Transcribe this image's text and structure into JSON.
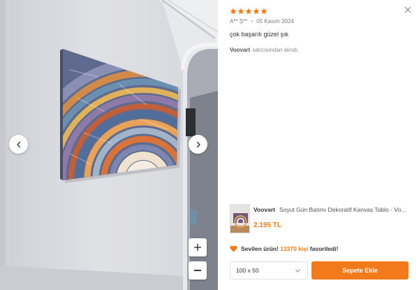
{
  "viewer": {
    "prev_icon": "chevron-left-icon",
    "next_icon": "chevron-right-icon",
    "zoom_in_icon": "plus-icon",
    "zoom_out_icon": "minus-icon"
  },
  "review": {
    "rating": 5,
    "rating_max": 5,
    "star_color": "#f27a1a",
    "author": "A** Ş**",
    "date": "05 Kasım 2024",
    "comment": "çok başarılı güzel şık",
    "seller_name": "Voovart",
    "seller_suffix": "satıcısından alındı.",
    "close_icon": "close-icon"
  },
  "product": {
    "brand": "Voovart",
    "title": "Soyut Gün Batımı Dekoratif Kanvas Tablo - Vo...",
    "price": "2.195 TL",
    "price_color": "#f27a1a"
  },
  "favorites": {
    "heart_icon": "heart-icon",
    "prefix": "Sevilen ürün!",
    "count": "13370 kişi",
    "suffix": "favoriledi!"
  },
  "actions": {
    "size_value": "100 x 50",
    "add_to_cart": "Sepete Ekle",
    "accent": "#f27a1a"
  }
}
